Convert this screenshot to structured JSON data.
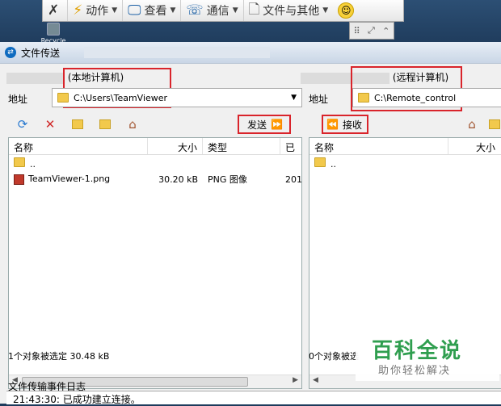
{
  "desktop": {
    "recycle_label": "Recycle Bin"
  },
  "tv_toolbar": {
    "items": [
      {
        "label": "",
        "icon": "close-x-icon"
      },
      {
        "label": "动作",
        "icon": "lightning-icon"
      },
      {
        "label": "查看",
        "icon": "monitor-icon"
      },
      {
        "label": "通信",
        "icon": "phone-icon"
      },
      {
        "label": "文件与其他",
        "icon": "file-icon"
      }
    ],
    "smiley": "smiley-icon"
  },
  "window": {
    "title": "文件传送"
  },
  "local": {
    "heading": "(本地计算机)",
    "address_label": "地址",
    "address": "C:\\Users\\TeamViewer",
    "send_label": "发送",
    "columns": [
      "名称",
      "大小",
      "类型",
      "已"
    ],
    "rows": [
      {
        "name": "..",
        "size": "",
        "type": "",
        "date": ""
      },
      {
        "name": "TeamViewer-1.png",
        "size": "30.20 kB",
        "type": "PNG 图像",
        "date": "201"
      }
    ],
    "status": "1个对象被选定  30.48 kB"
  },
  "remote": {
    "heading": "(远程计算机)",
    "address_label": "地址",
    "address": "C:\\Remote_control",
    "receive_label": "接收",
    "columns": [
      "名称",
      "大小"
    ],
    "rows": [
      {
        "name": "..",
        "size": ""
      }
    ],
    "status": "0个对象被选"
  },
  "log": {
    "label": "文件传输事件日志",
    "line": "21:43:30: 已成功建立连接。"
  },
  "watermark": {
    "title": "百科全说",
    "subtitle": "助你轻松解决"
  },
  "colors": {
    "highlight": "#d9242b",
    "accent": "#0e6bc0",
    "watermark": "#2f9e4f"
  }
}
